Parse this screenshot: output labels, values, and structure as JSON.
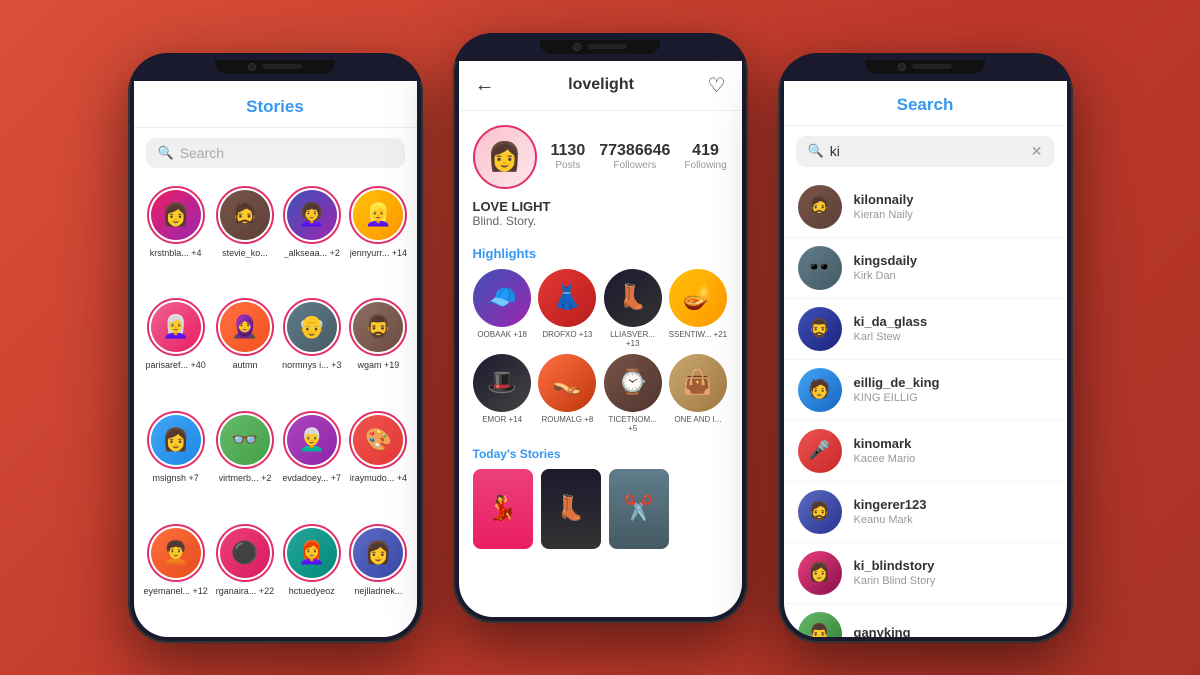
{
  "background": {
    "color": "#c0392b"
  },
  "phone_left": {
    "screen": "stories",
    "header": "Stories",
    "search_placeholder": "Search",
    "stories": [
      {
        "label": "krstnbla... +4",
        "av": "av1",
        "emoji": "👩"
      },
      {
        "label": "stevie_ko...",
        "av": "av2",
        "emoji": "🧔"
      },
      {
        "label": "_alkseaa... +2",
        "av": "av3",
        "emoji": "👩‍🦱"
      },
      {
        "label": "jennyurr... +14",
        "av": "av4",
        "emoji": "👱‍♀️"
      },
      {
        "label": "parisaref... +40",
        "av": "av5",
        "emoji": "👩‍🦳"
      },
      {
        "label": "autmn",
        "av": "av6",
        "emoji": "🧕"
      },
      {
        "label": "normnys i... +3",
        "av": "av7",
        "emoji": "👴"
      },
      {
        "label": "wgam +19",
        "av": "av8",
        "emoji": "🧔‍♂️"
      },
      {
        "label": "mslgnsh +7",
        "av": "av9",
        "emoji": "👩"
      },
      {
        "label": "virtmerb... +2",
        "av": "av10",
        "emoji": "👓"
      },
      {
        "label": "evdadoey... +7",
        "av": "av11",
        "emoji": "👨‍🦳"
      },
      {
        "label": "iraymudo... +4",
        "av": "av12",
        "emoji": "🎨"
      },
      {
        "label": "eyemanel... +12",
        "av": "av13",
        "emoji": "🧑‍🦱"
      },
      {
        "label": "rganaira... +22",
        "av": "av14",
        "emoji": "⚫"
      },
      {
        "label": "hctuedyeoz",
        "av": "av15",
        "emoji": "👩‍🦰"
      },
      {
        "label": "nejlladnek...",
        "av": "av16",
        "emoji": "👩"
      }
    ]
  },
  "phone_center": {
    "screen": "profile",
    "username": "lovelight",
    "stats": {
      "posts": {
        "value": "1130",
        "label": "Posts"
      },
      "followers": {
        "value": "77386646",
        "label": "Followers"
      },
      "following": {
        "value": "419",
        "label": "Following"
      }
    },
    "bio_name": "LOVE LIGHT",
    "bio_text": "Blind. Story.",
    "highlights_title": "Highlights",
    "highlights": [
      {
        "label": "OOBAAK +18",
        "hl": "hl1",
        "emoji": "🧢"
      },
      {
        "label": "DROFXO +13",
        "hl": "hl2",
        "emoji": "👗"
      },
      {
        "label": "LLIASVER... +13",
        "hl": "hl3",
        "emoji": "👢"
      },
      {
        "label": "SSENTIW... +21",
        "hl": "hl4",
        "emoji": "🪔"
      },
      {
        "label": "EMOR +14",
        "hl": "hl5",
        "emoji": "🎩"
      },
      {
        "label": "ROUMALG +8",
        "hl": "hl6",
        "emoji": "👡"
      },
      {
        "label": "TICETNOM... +5",
        "hl": "hl7",
        "emoji": "⌚"
      },
      {
        "label": "ONE AND I...",
        "hl": "hl8",
        "emoji": "👜"
      }
    ],
    "todays_stories_title": "Today's Stories",
    "today_stories": [
      {
        "ts": "ts1",
        "emoji": "💃"
      },
      {
        "ts": "ts2",
        "emoji": "👢"
      },
      {
        "ts": "ts3",
        "emoji": "✂️"
      }
    ]
  },
  "phone_right": {
    "screen": "search",
    "header": "Search",
    "search_query": "ki",
    "results": [
      {
        "username": "kilonnaily",
        "name": "Kieran Naily",
        "ra": "ra1",
        "emoji": "🧔"
      },
      {
        "username": "kingsdaily",
        "name": "Kirk Dan",
        "ra": "ra2",
        "emoji": "🕶️"
      },
      {
        "username": "ki_da_glass",
        "name": "Karl Stew",
        "ra": "ra3",
        "emoji": "🧔‍♂️"
      },
      {
        "username": "eillig_de_king",
        "name": "KING EILLIG",
        "ra": "ra4",
        "emoji": "🧑"
      },
      {
        "username": "kinomark",
        "name": "Kacee Mario",
        "ra": "ra5",
        "emoji": "🎤"
      },
      {
        "username": "kingerer123",
        "name": "Keanu Mark",
        "ra": "ra6",
        "emoji": "🧔"
      },
      {
        "username": "ki_blindstory",
        "name": "Karin Blind Story",
        "ra": "ra7",
        "emoji": "👩"
      },
      {
        "username": "ganyking",
        "name": "",
        "ra": "ra8",
        "emoji": "👨"
      }
    ]
  }
}
